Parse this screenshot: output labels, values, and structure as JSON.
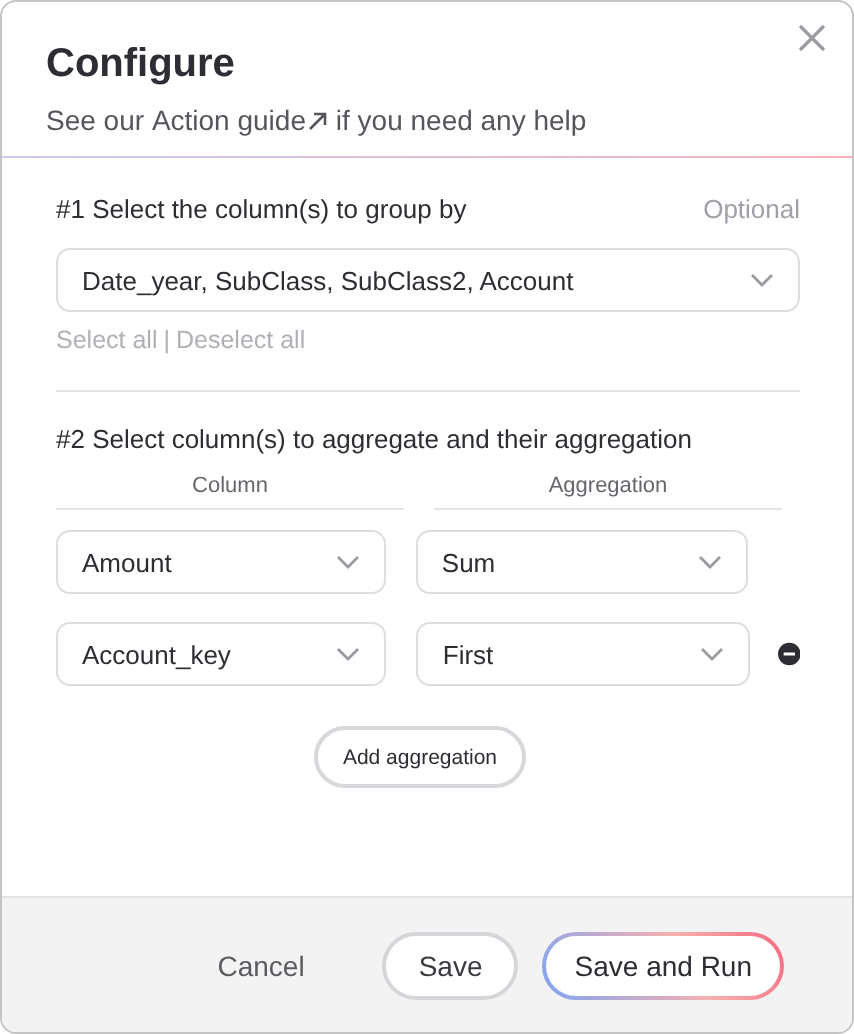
{
  "dialog": {
    "title": "Configure",
    "subtitle": {
      "before": "See our ",
      "link": "Action guide",
      "after": " if you need any help"
    }
  },
  "group_by": {
    "heading": "#1 Select the column(s) to group by",
    "optional": "Optional",
    "value": "Date_year, SubClass, SubClass2, Account",
    "select_all": "Select all",
    "separator": "|",
    "deselect_all": "Deselect all"
  },
  "aggregate": {
    "heading": "#2 Select column(s) to aggregate and their aggregation",
    "column_header": "Column",
    "aggregation_header": "Aggregation",
    "rows": [
      {
        "column": "Amount",
        "aggregation": "Sum",
        "removable": false
      },
      {
        "column": "Account_key",
        "aggregation": "First",
        "removable": true
      }
    ],
    "add_button": "Add aggregation"
  },
  "footer": {
    "buttons": [
      {
        "label": "Cancel",
        "kind": "text"
      },
      {
        "label": "Save",
        "kind": "outline"
      },
      {
        "label": "Save and Run",
        "kind": "gradient"
      }
    ]
  }
}
